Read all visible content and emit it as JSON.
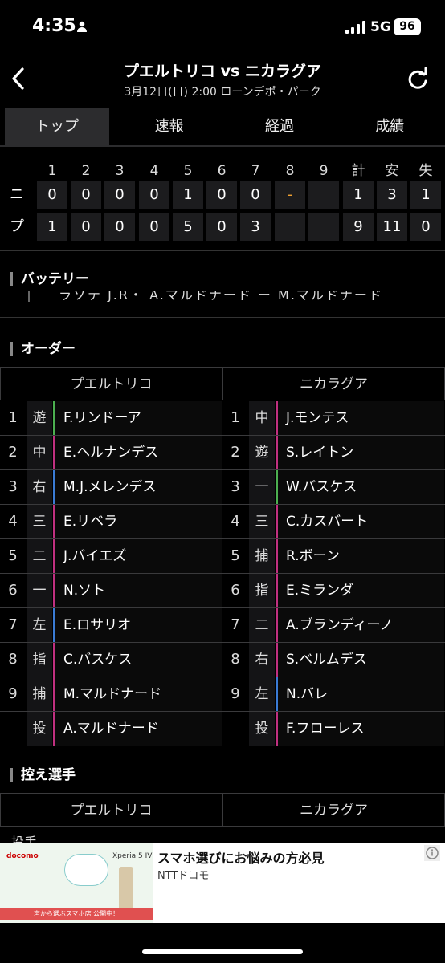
{
  "status": {
    "time": "4:35",
    "network": "5G",
    "battery": "96"
  },
  "header": {
    "title": "プエルトリコ vs ニカラグア",
    "subtitle": "3月12日(日) 2:00 ローンデポ・パーク"
  },
  "tabs": [
    {
      "label": "トップ",
      "active": true
    },
    {
      "label": "速報",
      "active": false
    },
    {
      "label": "経過",
      "active": false
    },
    {
      "label": "成績",
      "active": false
    }
  ],
  "scoreboard": {
    "headers": [
      "1",
      "2",
      "3",
      "4",
      "5",
      "6",
      "7",
      "8",
      "9",
      "計",
      "安",
      "失"
    ],
    "rows": [
      {
        "team": "ニ",
        "cells": [
          "0",
          "0",
          "0",
          "0",
          "1",
          "0",
          "0",
          "-",
          "",
          "1",
          "3",
          "1"
        ]
      },
      {
        "team": "プ",
        "cells": [
          "1",
          "0",
          "0",
          "0",
          "5",
          "0",
          "3",
          "",
          "",
          "9",
          "11",
          "0"
        ]
      }
    ]
  },
  "battery_section": {
    "title": "バッテリー",
    "partial_text": "ラソテ J.R・ A.マルドナード ー M.マルドナード"
  },
  "order_section": {
    "title": "オーダー",
    "home_team": "プエルトリコ",
    "away_team": "ニカラグア",
    "home": [
      {
        "num": "1",
        "pos": "遊",
        "name": "F.リンドーア",
        "color": "#4caf50"
      },
      {
        "num": "2",
        "pos": "中",
        "name": "E.ヘルナンデス",
        "color": "#c03080"
      },
      {
        "num": "3",
        "pos": "右",
        "name": "M.J.メレンデス",
        "color": "#3a7bd5"
      },
      {
        "num": "4",
        "pos": "三",
        "name": "E.リベラ",
        "color": "#c03080"
      },
      {
        "num": "5",
        "pos": "二",
        "name": "J.バイエズ",
        "color": "#c03080"
      },
      {
        "num": "6",
        "pos": "一",
        "name": "N.ソト",
        "color": "#c03080"
      },
      {
        "num": "7",
        "pos": "左",
        "name": "E.ロサリオ",
        "color": "#3a7bd5"
      },
      {
        "num": "8",
        "pos": "指",
        "name": "C.バスケス",
        "color": "#c03080"
      },
      {
        "num": "9",
        "pos": "捕",
        "name": "M.マルドナード",
        "color": "#c03080"
      },
      {
        "num": "",
        "pos": "投",
        "name": "A.マルドナード",
        "color": "#c03080"
      }
    ],
    "away": [
      {
        "num": "1",
        "pos": "中",
        "name": "J.モンテス",
        "color": "#c03080"
      },
      {
        "num": "2",
        "pos": "遊",
        "name": "S.レイトン",
        "color": "#c03080"
      },
      {
        "num": "3",
        "pos": "一",
        "name": "W.バスケス",
        "color": "#4caf50"
      },
      {
        "num": "4",
        "pos": "三",
        "name": "C.カスバート",
        "color": "#c03080"
      },
      {
        "num": "5",
        "pos": "捕",
        "name": "R.ボーン",
        "color": "#c03080"
      },
      {
        "num": "6",
        "pos": "指",
        "name": "E.ミランダ",
        "color": "#c03080"
      },
      {
        "num": "7",
        "pos": "二",
        "name": "A.ブランディーノ",
        "color": "#c03080"
      },
      {
        "num": "8",
        "pos": "右",
        "name": "S.ベルムデス",
        "color": "#c03080"
      },
      {
        "num": "9",
        "pos": "左",
        "name": "N.バレ",
        "color": "#3a7bd5"
      },
      {
        "num": "",
        "pos": "投",
        "name": "F.フローレス",
        "color": "#c03080"
      }
    ]
  },
  "bench_section": {
    "title": "控え選手",
    "home_team": "プエルトリコ",
    "away_team": "ニカラグア",
    "partial_label": "投手"
  },
  "ad": {
    "brand": "docomo",
    "product": "Xperia 5 IV",
    "tagline": "声から選ぶスマホ店 公開中！",
    "title": "スマホ選びにお悩みの方必見",
    "sponsor": "NTTドコモ"
  }
}
